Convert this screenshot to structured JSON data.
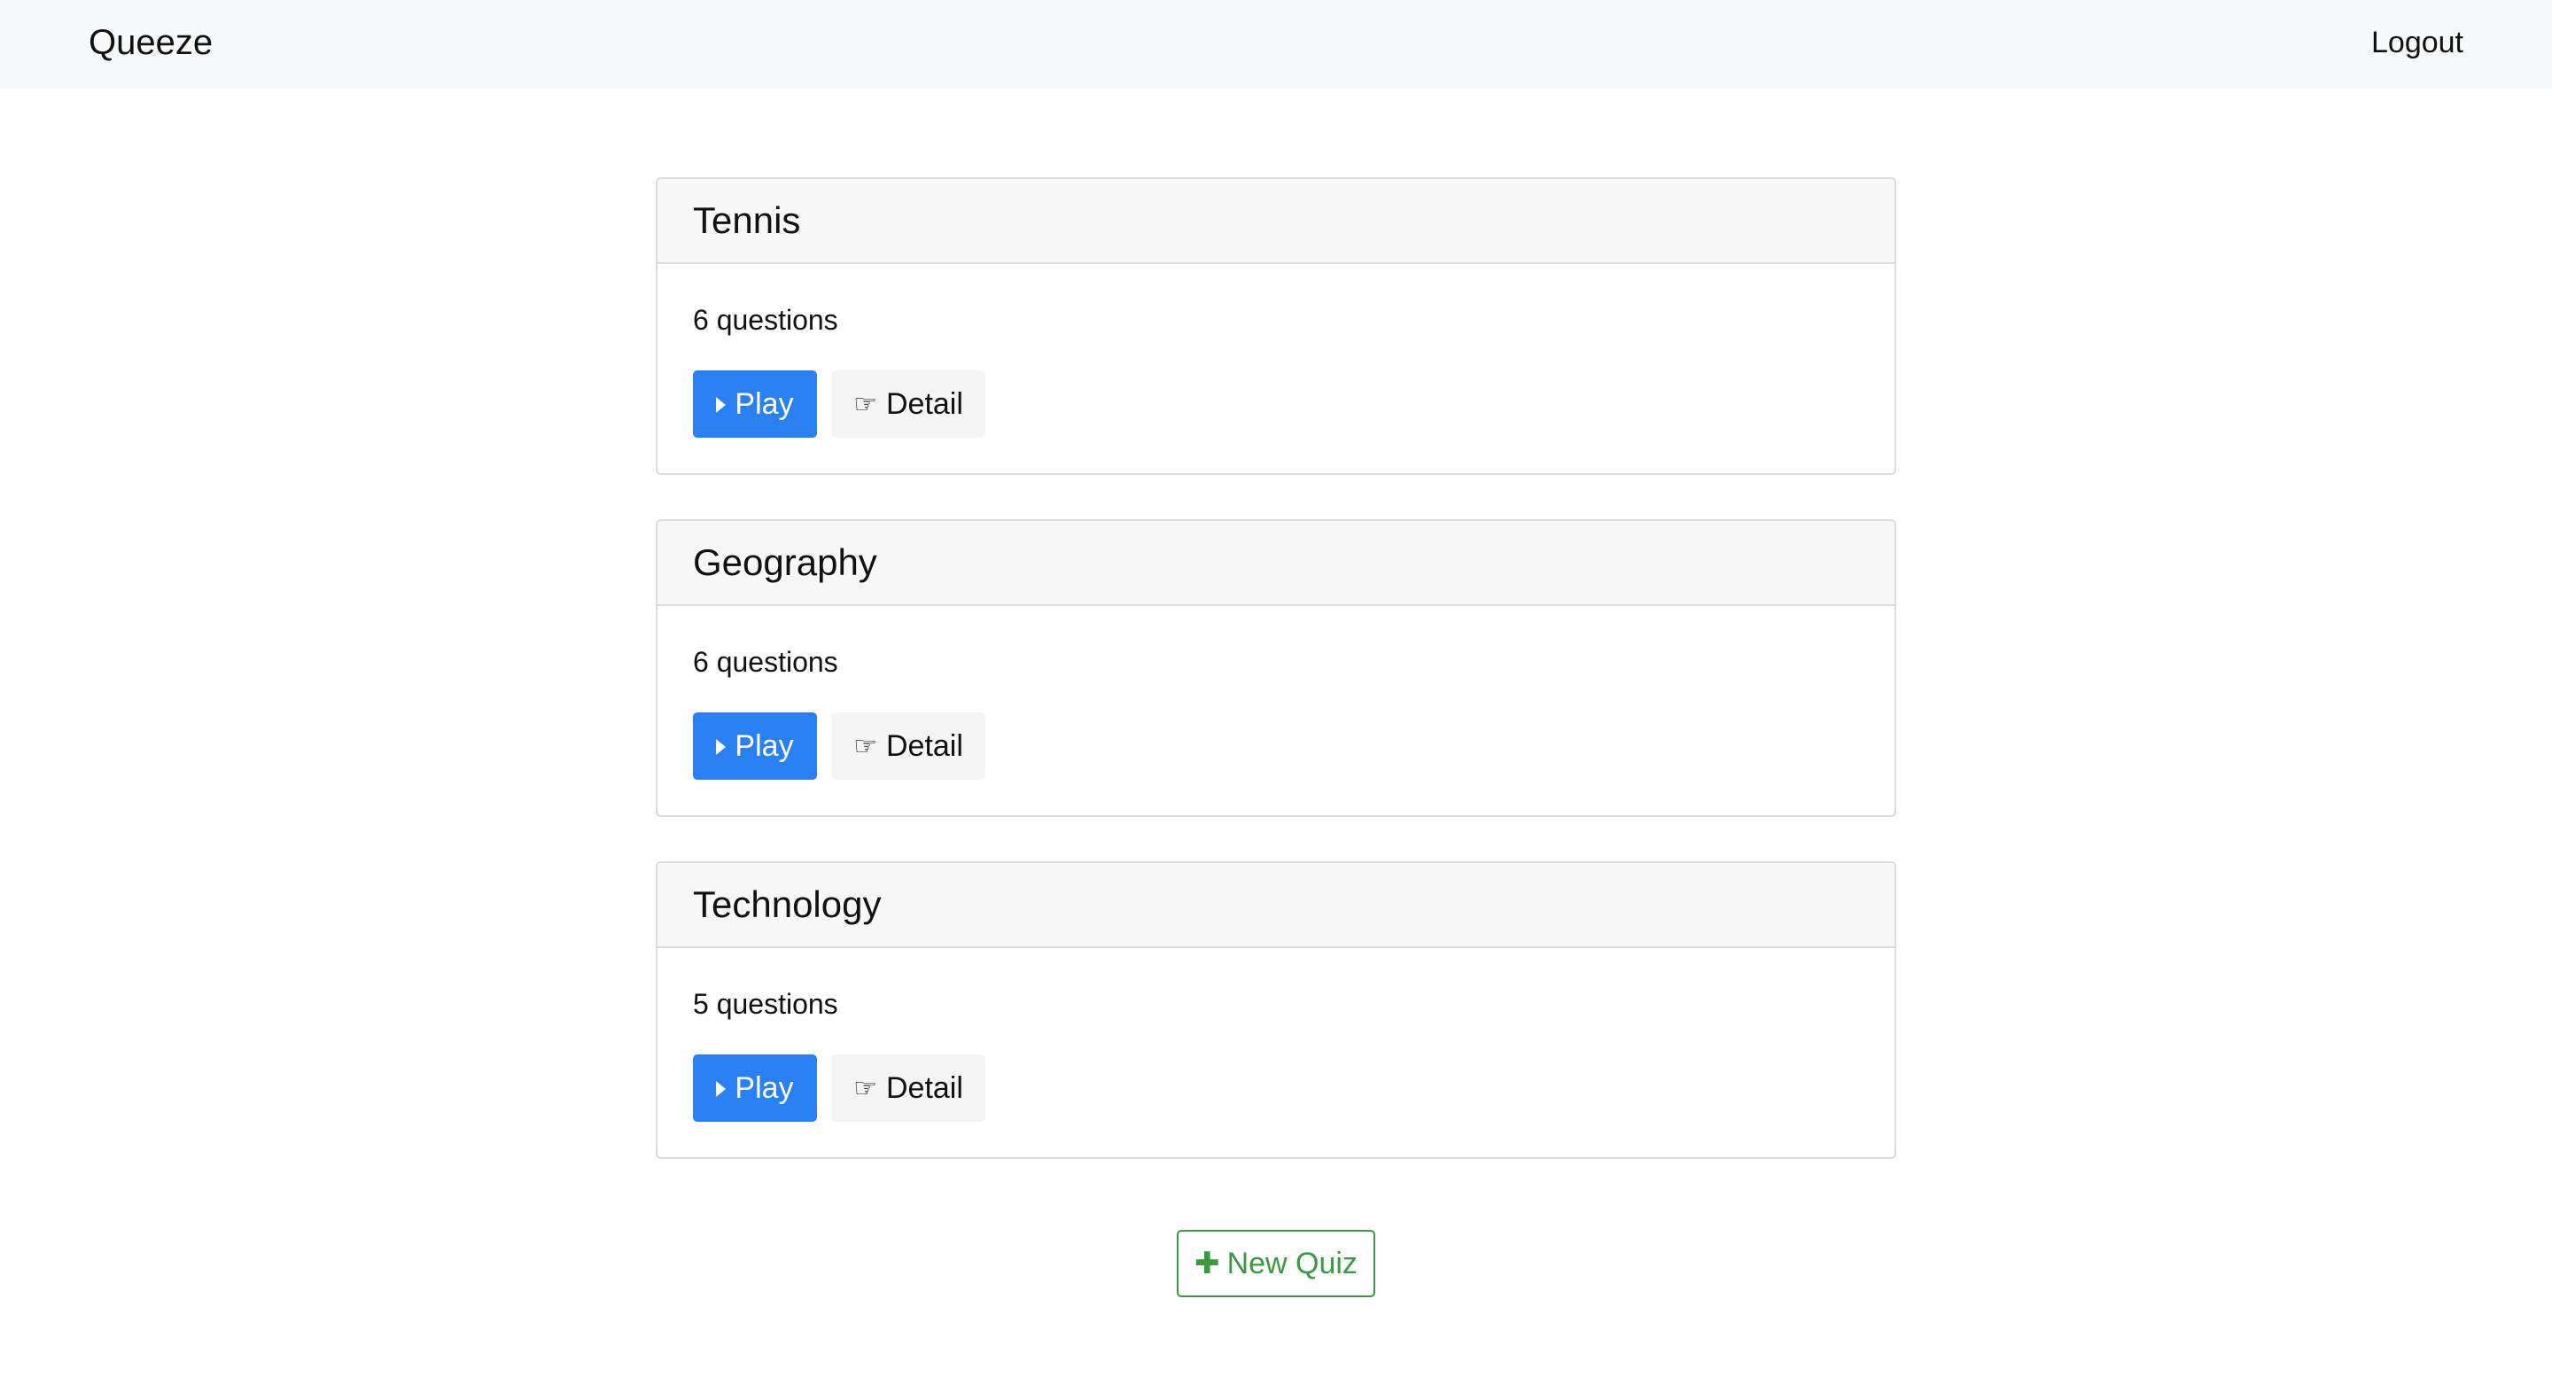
{
  "navbar": {
    "brand": "Queeze",
    "logout": "Logout"
  },
  "quizzes": [
    {
      "title": "Tennis",
      "questions": "6 questions",
      "play_label": "Play",
      "detail_label": "Detail"
    },
    {
      "title": "Geography",
      "questions": "6 questions",
      "play_label": "Play",
      "detail_label": "Detail"
    },
    {
      "title": "Technology",
      "questions": "5 questions",
      "play_label": "Play",
      "detail_label": "Detail"
    }
  ],
  "new_quiz_label": "New Quiz",
  "icons": {
    "play": "play-icon",
    "detail": "pointing-hand-icon",
    "new_quiz": "plus-icon"
  },
  "colors": {
    "primary": "#2980f3",
    "success": "#3a9a3f",
    "navbar_bg": "#f8f9fa"
  }
}
